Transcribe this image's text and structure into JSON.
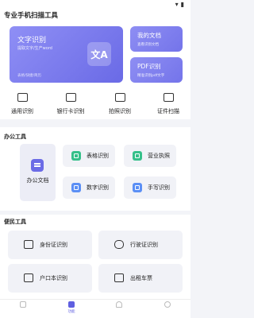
{
  "status_bar": {
    "wifi_icon": "wifi-icon",
    "battery_icon": "battery-icon"
  },
  "app_title": "专业手机扫描工具",
  "hero_card": {
    "title": "文字识别",
    "subtitle": "提取文字/生产word",
    "tags": "表格/快捷/简历"
  },
  "my_docs_card": {
    "title": "我的文档",
    "subtitle": "查看识别文档"
  },
  "pdf_card": {
    "title": "PDF识别",
    "subtitle": "精准识别pdf文字"
  },
  "quick_actions": [
    {
      "label": "通用识别",
      "icon": "camera-icon"
    },
    {
      "label": "银行卡识别",
      "icon": "bank-card-icon"
    },
    {
      "label": "拍照识别",
      "icon": "photo-icon"
    },
    {
      "label": "证件扫描",
      "icon": "id-card-icon"
    }
  ],
  "office": {
    "title": "办公工具",
    "main_tile": {
      "label": "办公文档",
      "icon": "document-icon"
    },
    "tiles": [
      {
        "label": "表格识别",
        "icon": "table-icon",
        "color": "#36c08a"
      },
      {
        "label": "营业执照",
        "icon": "license-icon",
        "color": "#36c08a"
      },
      {
        "label": "数字识别",
        "icon": "number-icon",
        "color": "#5b8ff5"
      },
      {
        "label": "手写识别",
        "icon": "handwriting-icon",
        "color": "#5b8ff5"
      }
    ]
  },
  "civil": {
    "title": "便民工具",
    "tiles": [
      {
        "label": "身份证识别",
        "icon": "id-card-icon"
      },
      {
        "label": "行驶证识别",
        "icon": "car-icon"
      },
      {
        "label": "户口本识别",
        "icon": "household-book-icon"
      },
      {
        "label": "出租车票",
        "icon": "taxi-ticket-icon"
      }
    ]
  },
  "tabbar": [
    {
      "label": "",
      "icon": "home-icon",
      "active": false
    },
    {
      "label": "功能",
      "icon": "apps-icon",
      "active": true
    },
    {
      "label": "",
      "icon": "bell-icon",
      "active": false
    },
    {
      "label": "",
      "icon": "user-icon",
      "active": false
    }
  ]
}
